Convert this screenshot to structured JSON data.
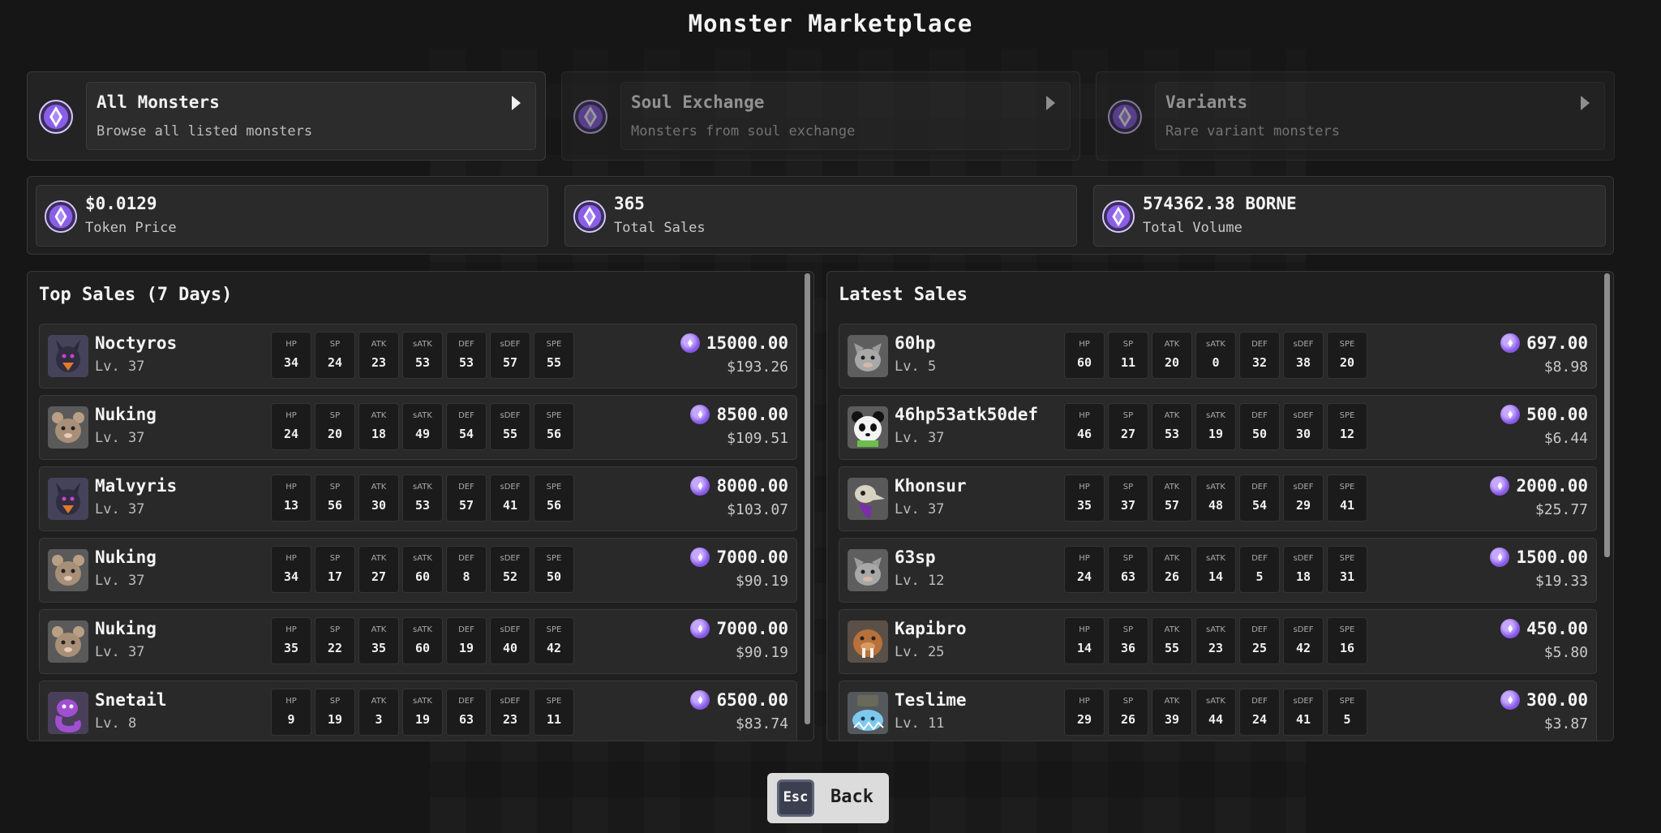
{
  "title": "Monster Marketplace",
  "categories": [
    {
      "name": "All Monsters",
      "desc": "Browse all listed monsters",
      "active": true
    },
    {
      "name": "Soul Exchange",
      "desc": "Monsters from soul exchange",
      "active": false
    },
    {
      "name": "Variants",
      "desc": "Rare variant monsters",
      "active": false
    }
  ],
  "stats": [
    {
      "value": "$0.0129",
      "label": "Token Price"
    },
    {
      "value": "365",
      "label": "Total Sales"
    },
    {
      "value": "574362.38 BORNE",
      "label": "Total Volume"
    }
  ],
  "stat_labels": [
    "HP",
    "SP",
    "ATK",
    "sATK",
    "DEF",
    "sDEF",
    "SPE"
  ],
  "top_sales": {
    "title": "Top Sales (7 Days)",
    "rows": [
      {
        "name": "Noctyros",
        "level": "Lv. 37",
        "stats": [
          "34",
          "24",
          "23",
          "53",
          "53",
          "57",
          "55"
        ],
        "price": "15000.00",
        "usd": "$193.26",
        "icon": "dark-bird-icon"
      },
      {
        "name": "Nuking",
        "level": "Lv. 37",
        "stats": [
          "24",
          "20",
          "18",
          "49",
          "54",
          "55",
          "56"
        ],
        "price": "8500.00",
        "usd": "$109.51",
        "icon": "rat-icon"
      },
      {
        "name": "Malvyris",
        "level": "Lv. 37",
        "stats": [
          "13",
          "56",
          "30",
          "53",
          "57",
          "41",
          "56"
        ],
        "price": "8000.00",
        "usd": "$103.07",
        "icon": "dark-bird-icon"
      },
      {
        "name": "Nuking",
        "level": "Lv. 37",
        "stats": [
          "34",
          "17",
          "27",
          "60",
          "8",
          "52",
          "50"
        ],
        "price": "7000.00",
        "usd": "$90.19",
        "icon": "rat-icon"
      },
      {
        "name": "Nuking",
        "level": "Lv. 37",
        "stats": [
          "35",
          "22",
          "35",
          "60",
          "19",
          "40",
          "42"
        ],
        "price": "7000.00",
        "usd": "$90.19",
        "icon": "rat-icon"
      },
      {
        "name": "Snetail",
        "level": "Lv. 8",
        "stats": [
          "9",
          "19",
          "3",
          "19",
          "63",
          "23",
          "11"
        ],
        "price": "6500.00",
        "usd": "$83.74",
        "icon": "purple-snake-icon"
      }
    ]
  },
  "latest_sales": {
    "title": "Latest Sales",
    "rows": [
      {
        "name": "60hp",
        "level": "Lv. 5",
        "stats": [
          "60",
          "11",
          "20",
          "0",
          "32",
          "38",
          "20"
        ],
        "price": "697.00",
        "usd": "$8.98",
        "icon": "gray-creature-icon"
      },
      {
        "name": "46hp53atk50def",
        "level": "Lv. 37",
        "stats": [
          "46",
          "27",
          "53",
          "19",
          "50",
          "30",
          "12"
        ],
        "price": "500.00",
        "usd": "$6.44",
        "icon": "panda-icon"
      },
      {
        "name": "Khonsur",
        "level": "Lv. 37",
        "stats": [
          "35",
          "37",
          "57",
          "48",
          "54",
          "29",
          "41"
        ],
        "price": "2000.00",
        "usd": "$25.77",
        "icon": "skull-bird-icon"
      },
      {
        "name": "63sp",
        "level": "Lv. 12",
        "stats": [
          "24",
          "63",
          "26",
          "14",
          "5",
          "18",
          "31"
        ],
        "price": "1500.00",
        "usd": "$19.33",
        "icon": "gray-creature-icon"
      },
      {
        "name": "Kapibro",
        "level": "Lv. 25",
        "stats": [
          "14",
          "36",
          "55",
          "23",
          "25",
          "42",
          "16"
        ],
        "price": "450.00",
        "usd": "$5.80",
        "icon": "walrus-icon"
      },
      {
        "name": "Teslime",
        "level": "Lv. 11",
        "stats": [
          "29",
          "26",
          "39",
          "44",
          "24",
          "41",
          "5"
        ],
        "price": "300.00",
        "usd": "$3.87",
        "icon": "slime-icon"
      }
    ]
  },
  "back": {
    "key": "Esc",
    "label": "Back"
  }
}
